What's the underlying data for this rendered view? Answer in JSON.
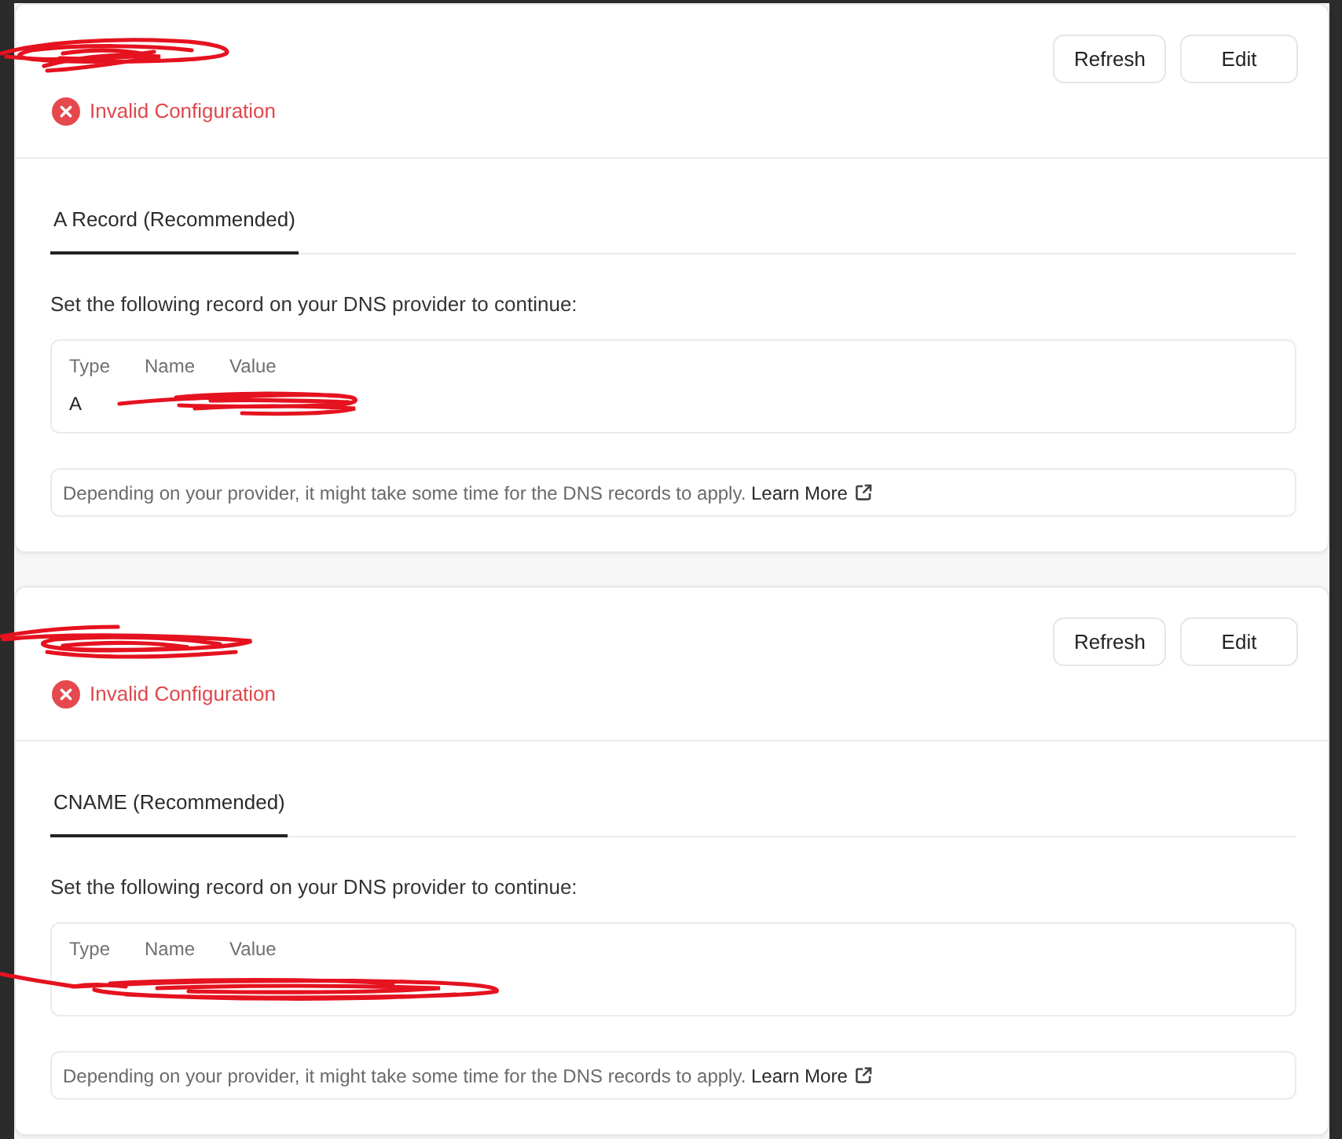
{
  "domains": [
    {
      "status": {
        "kind": "error",
        "label": "Invalid Configuration"
      },
      "actions": [
        "Refresh",
        "Edit"
      ],
      "tabs": [
        {
          "label": "A Record (Recommended)",
          "selected": true
        }
      ],
      "instruction": "Set the following record on your DNS provider to continue:",
      "records": {
        "columns": [
          "Type",
          "Name",
          "Value"
        ],
        "rows": [
          [
            "A"
          ]
        ]
      },
      "note": {
        "text": "Depending on your provider, it might take some time for the DNS records to apply.",
        "link": "Learn More"
      }
    },
    {
      "status": {
        "kind": "error",
        "label": "Invalid Configuration"
      },
      "actions": [
        "Refresh",
        "Edit"
      ],
      "tabs": [
        {
          "label": "CNAME (Recommended)",
          "selected": true
        }
      ],
      "instruction": "Set the following record on your DNS provider to continue:",
      "records": {
        "columns": [
          "Type",
          "Name",
          "Value"
        ]
      },
      "note": {
        "text": "Depending on your provider, it might take some time for the DNS records to apply.",
        "link": "Learn More"
      }
    }
  ]
}
